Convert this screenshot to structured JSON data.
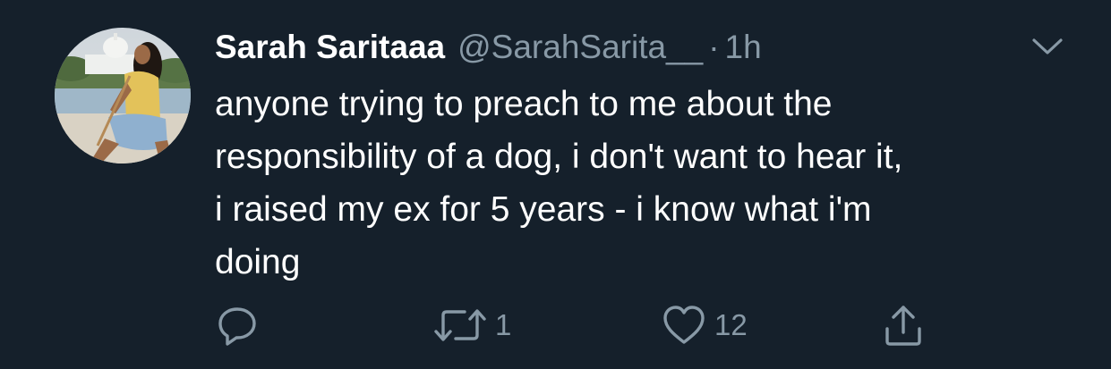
{
  "tweet": {
    "display_name": "Sarah Saritaaa",
    "handle": "@SarahSarita__",
    "separator": "·",
    "time": "1h",
    "text": "anyone trying to preach to me about the\nresponsibility of a dog, i don't want to hear it,\ni raised my ex for 5 years - i know what i'm\ndoing"
  },
  "actions": {
    "reply": {
      "icon": "reply-icon",
      "count": ""
    },
    "retweet": {
      "icon": "retweet-icon",
      "count": "1"
    },
    "like": {
      "icon": "heart-icon",
      "count": "12"
    },
    "share": {
      "icon": "share-icon",
      "count": ""
    }
  },
  "menu": {
    "icon": "chevron-down-icon"
  },
  "colors": {
    "background": "#15202b",
    "primary_text": "#ffffff",
    "secondary_text": "#8899a6"
  }
}
